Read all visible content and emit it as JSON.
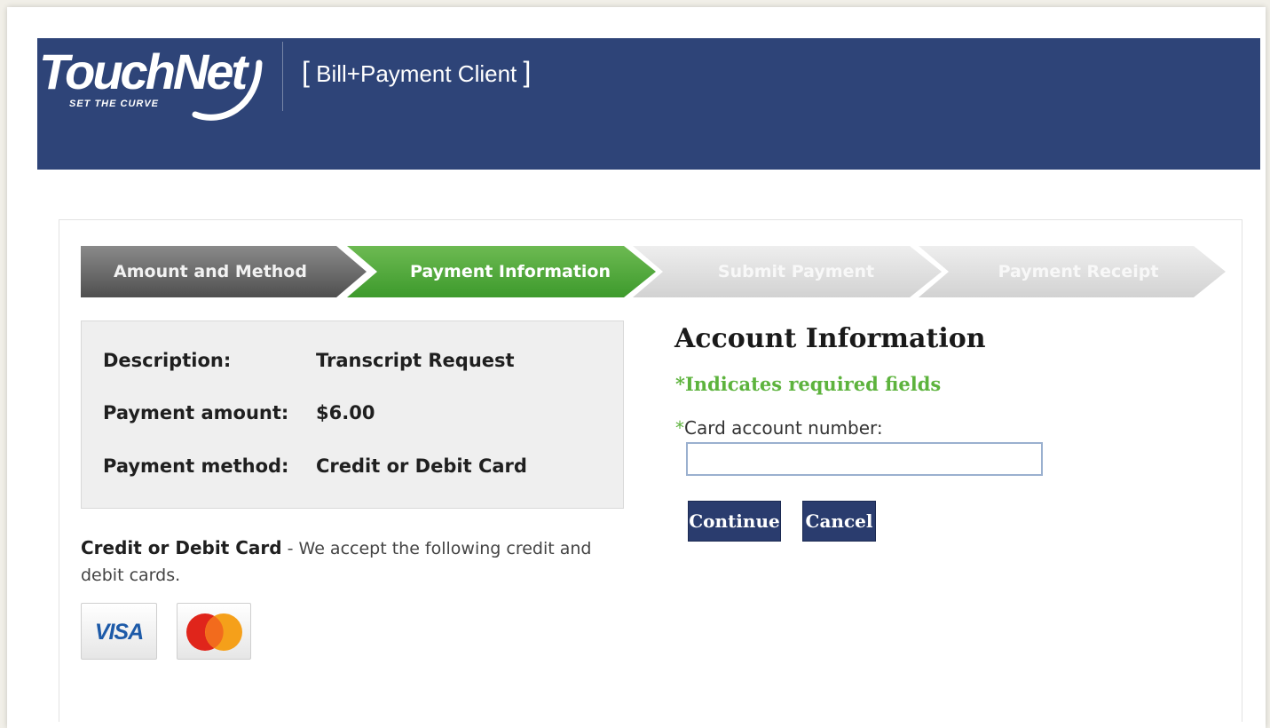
{
  "header": {
    "logo_text": "TouchNet",
    "logo_tagline": "SET THE CURVE",
    "product_title": "Bill+Payment Client",
    "bracket_open": "[",
    "bracket_close": "]",
    "brand_color": "#2e4478"
  },
  "steps": [
    {
      "label": "Amount and Method",
      "state": "completed"
    },
    {
      "label": "Payment Information",
      "state": "active"
    },
    {
      "label": "Submit Payment",
      "state": "pending"
    },
    {
      "label": "Payment Receipt",
      "state": "pending"
    }
  ],
  "summary": {
    "description_label": "Description:",
    "description_value": "Transcript Request",
    "amount_label": "Payment amount:",
    "amount_value": "$6.00",
    "method_label": "Payment method:",
    "method_value": "Credit or Debit Card"
  },
  "card_note": {
    "title": "Credit or Debit Card",
    "separator": " - ",
    "text": "We accept the following credit and debit cards."
  },
  "cards": [
    {
      "name": "VISA",
      "icon": "visa-logo-icon"
    },
    {
      "name": "MasterCard",
      "icon": "mastercard-logo-icon"
    }
  ],
  "account": {
    "title": "Account Information",
    "required_note": "*Indicates required fields",
    "required_marker": "*",
    "card_number_label": "Card account number:",
    "card_number_value": "",
    "continue_label": "Continue",
    "cancel_label": "Cancel",
    "accent_color": "#5db33d",
    "button_color": "#2a3c6e"
  }
}
